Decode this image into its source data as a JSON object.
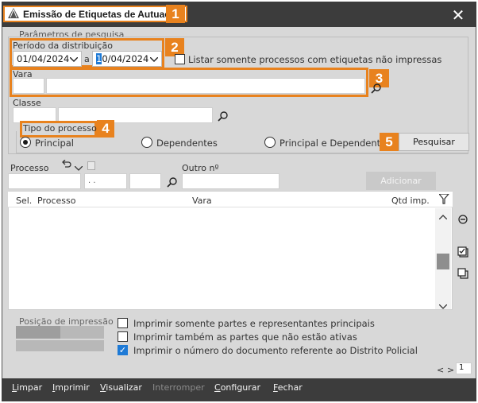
{
  "window": {
    "title": "Emissão de Etiquetas de Autuação",
    "close_label": "✕",
    "accent_color": "#e8821e",
    "titlebar_color": "#3c3c3c"
  },
  "badges": [
    "1",
    "2",
    "3",
    "4",
    "5"
  ],
  "search": {
    "group_label": "Parâmetros de pesquisa",
    "period": {
      "label": "Período da distribuição",
      "from_prefix": "01/04/2024",
      "connector": "a",
      "to_highlight": "1",
      "to_rest": "0/04/2024",
      "only_unprinted_label": "Listar somente processos com etiquetas não impressas",
      "only_unprinted_checked": false
    },
    "vara_label": "Vara",
    "classe_label": "Classe",
    "tipo_label": "Tipo do processo",
    "tipo_options": [
      {
        "label": "Principal",
        "selected": true
      },
      {
        "label": "Dependentes",
        "selected": false
      },
      {
        "label": "Principal e Dependentes",
        "selected": false
      }
    ],
    "search_button": "Pesquisar"
  },
  "add_section": {
    "processo_label": "Processo",
    "processo_mid_value": ". .",
    "outro_label": "Outro nº",
    "add_button": "Adicionar"
  },
  "grid": {
    "columns": [
      "Sel.",
      "Processo",
      "Vara",
      "Qtd imp."
    ],
    "rows": []
  },
  "print_options": {
    "position_label": "Posição de impressão",
    "options": [
      {
        "label": "Imprimir somente partes e representantes principais",
        "checked": false
      },
      {
        "label": "Imprimir também as partes que não estão ativas",
        "checked": false
      },
      {
        "label": "Imprimir o número do documento referente ao Distrito Policial",
        "checked": true
      }
    ]
  },
  "pager": {
    "prev": "<",
    "next": ">",
    "page": "1"
  },
  "menu": [
    {
      "key": "L",
      "rest": "impar",
      "disabled": false
    },
    {
      "key": "I",
      "rest": "mprimir",
      "disabled": false
    },
    {
      "key": "V",
      "rest": "isualizar",
      "disabled": false
    },
    {
      "key": "",
      "rest": "Interromper",
      "disabled": true
    },
    {
      "key": "C",
      "rest": "onfigurar",
      "disabled": false
    },
    {
      "key": "F",
      "rest": "echar",
      "disabled": false
    }
  ]
}
